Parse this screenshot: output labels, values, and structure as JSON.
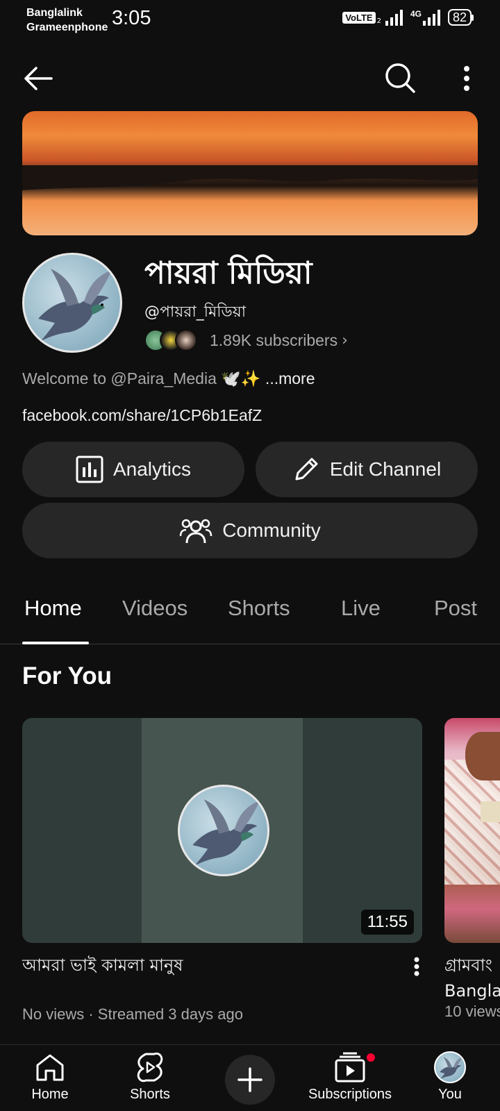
{
  "status_bar": {
    "carrier1": "Banglalink",
    "carrier2": "Grameenphone",
    "time": "3:05",
    "volte": "VoLTE",
    "sim_index": "2",
    "network": "4G",
    "battery": "82"
  },
  "top_bar": {
    "back_icon": "arrow-left-icon",
    "search_icon": "search-icon",
    "more_icon": "more-vertical-icon"
  },
  "channel": {
    "name": "পায়রা মিডিয়া",
    "handle": "@পায়রা_মিডিয়া",
    "subscribers": "1.89K subscribers",
    "description": "Welcome to @Paira_Media 🕊️✨",
    "description_more": " ...more",
    "link": "facebook.com/share/1CP6b1EafZ"
  },
  "actions": {
    "analytics": "Analytics",
    "edit_channel": "Edit Channel",
    "community": "Community"
  },
  "tabs": [
    {
      "label": "Home",
      "active": true
    },
    {
      "label": "Videos",
      "active": false
    },
    {
      "label": "Shorts",
      "active": false
    },
    {
      "label": "Live",
      "active": false
    },
    {
      "label": "Post",
      "active": false
    }
  ],
  "section": {
    "title": "For You"
  },
  "videos": [
    {
      "title": "আমরা ভাই কামলা মানুষ",
      "meta": "No views · Streamed 3 days ago",
      "duration": "11:55"
    },
    {
      "title": "গ্রামবাংলা Bangla",
      "title_line1": "গ্রামবাং",
      "title_line2": "Bangla",
      "meta": "10 views"
    }
  ],
  "bottom_nav": {
    "home": "Home",
    "shorts": "Shorts",
    "subscriptions": "Subscriptions",
    "you": "You"
  },
  "colors": {
    "background": "#0f0f0f",
    "pill": "#272727",
    "secondary_text": "#aaaaaa",
    "notification": "#ff0033"
  }
}
